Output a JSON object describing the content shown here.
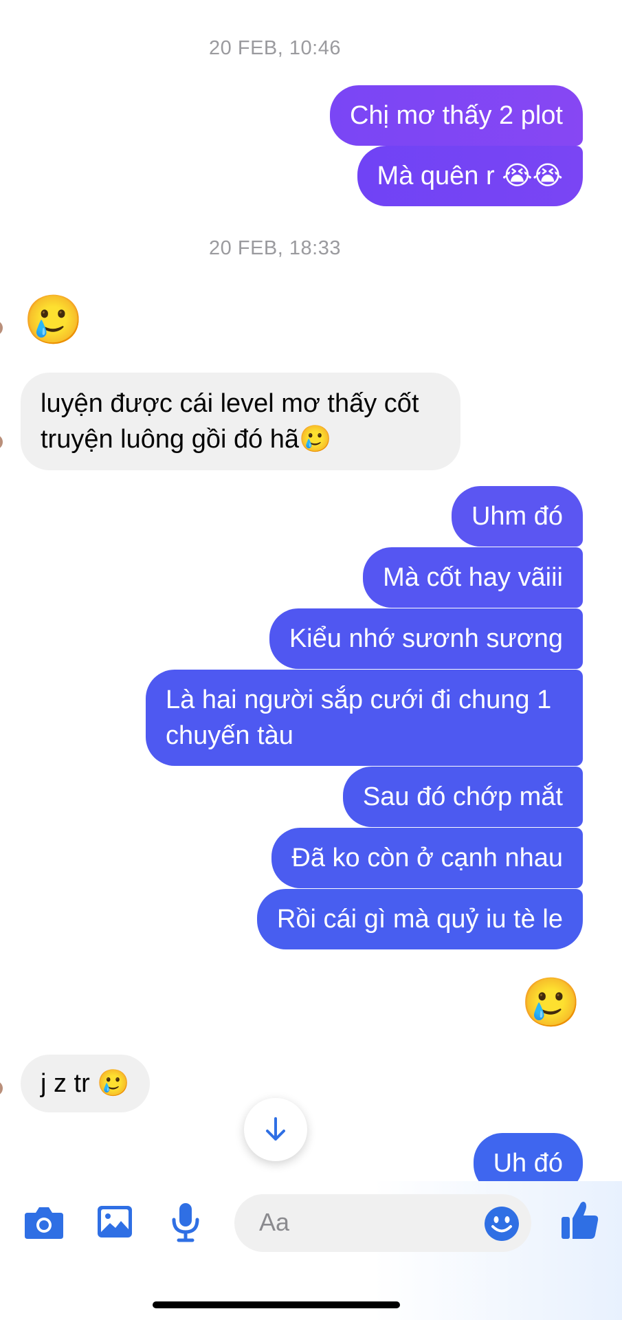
{
  "timestamps": [
    "20 FEB, 10:46",
    "20 FEB, 18:33"
  ],
  "messages": {
    "m1": "Chị mơ thấy 2 plot",
    "m2": "Mà quên r 😭😭",
    "r1_emoji": "🥲",
    "r2": "luyện được cái level mơ thấy cốt truyện luông gồi đó hã🥲",
    "m3": "Uhm đó",
    "m4": "Mà cốt hay vãiii",
    "m5": "Kiểu nhớ sươnh sương",
    "m6": "Là hai người sắp cưới đi chung 1 chuyến tàu",
    "m7": "Sau đó chớp mắt",
    "m8": "Đã ko còn ở cạnh nhau",
    "m9": "Rồi cái gì mà quỷ iu tè le",
    "m10_emoji": "🥲",
    "r3": "j z tr 🥲",
    "m11": "Uh đó"
  },
  "composer": {
    "placeholder": "Aa",
    "icons": [
      "camera-icon",
      "image-icon",
      "microphone-icon",
      "emoji-icon",
      "thumbs-up-icon"
    ]
  },
  "colors": {
    "outgoing_purple": "#7b47f5",
    "outgoing_blue": "#4c5bf0",
    "incoming_gray": "#f0f0f0",
    "accent_blue": "#2f6fe4"
  }
}
